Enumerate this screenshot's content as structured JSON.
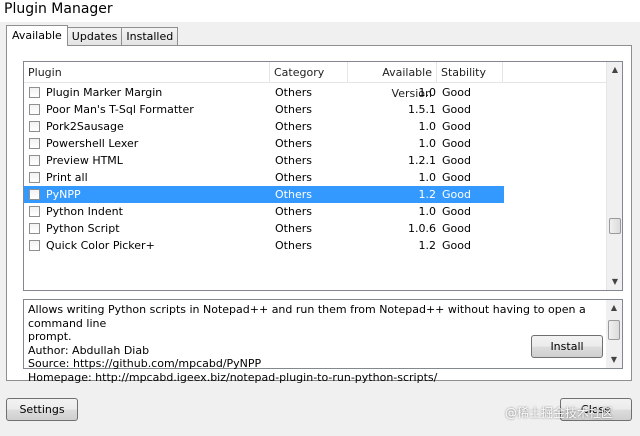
{
  "window": {
    "title": "Plugin Manager"
  },
  "tabs": [
    "Available",
    "Updates",
    "Installed"
  ],
  "list": {
    "columns": [
      "Plugin",
      "Category",
      "Available Version",
      "Stability"
    ],
    "rows": [
      {
        "name": "Plugin Marker Margin",
        "category": "Others",
        "version": "1.0",
        "stability": "Good",
        "selected": false
      },
      {
        "name": "Poor Man's T-Sql Formatter",
        "category": "Others",
        "version": "1.5.1",
        "stability": "Good",
        "selected": false
      },
      {
        "name": "Pork2Sausage",
        "category": "Others",
        "version": "1.0",
        "stability": "Good",
        "selected": false
      },
      {
        "name": "Powershell Lexer",
        "category": "Others",
        "version": "1.0",
        "stability": "Good",
        "selected": false
      },
      {
        "name": "Preview HTML",
        "category": "Others",
        "version": "1.2.1",
        "stability": "Good",
        "selected": false
      },
      {
        "name": "Print all",
        "category": "Others",
        "version": "1.0",
        "stability": "Good",
        "selected": false
      },
      {
        "name": "PyNPP",
        "category": "Others",
        "version": "1.2",
        "stability": "Good",
        "selected": true
      },
      {
        "name": "Python Indent",
        "category": "Others",
        "version": "1.0",
        "stability": "Good",
        "selected": false
      },
      {
        "name": "Python Script",
        "category": "Others",
        "version": "1.0.6",
        "stability": "Good",
        "selected": false
      },
      {
        "name": "Quick Color Picker+",
        "category": "Others",
        "version": "1.2",
        "stability": "Good",
        "selected": false
      }
    ],
    "scroll_position_fraction": 0.78
  },
  "description": {
    "lines": [
      "Allows writing Python scripts in Notepad++ and run them from Notepad++ without having to open a command line",
      "prompt.",
      "Author: Abdullah Diab",
      "Source: https://github.com/mpcabd/PyNPP",
      "Homepage: http://mpcabd.igeex.biz/notepad-plugin-to-run-python-scripts/"
    ]
  },
  "buttons": {
    "install": "Install",
    "settings": "Settings",
    "close": "Close"
  },
  "watermark": "@稀土掘金技术社区",
  "colors": {
    "selection": "#3399ff",
    "panel": "#ffffff",
    "chrome": "#f0f0f0"
  },
  "icons": {
    "scroll_up": "up-arrow-icon",
    "scroll_down": "down-arrow-icon",
    "checkbox": "checkbox-icon"
  }
}
